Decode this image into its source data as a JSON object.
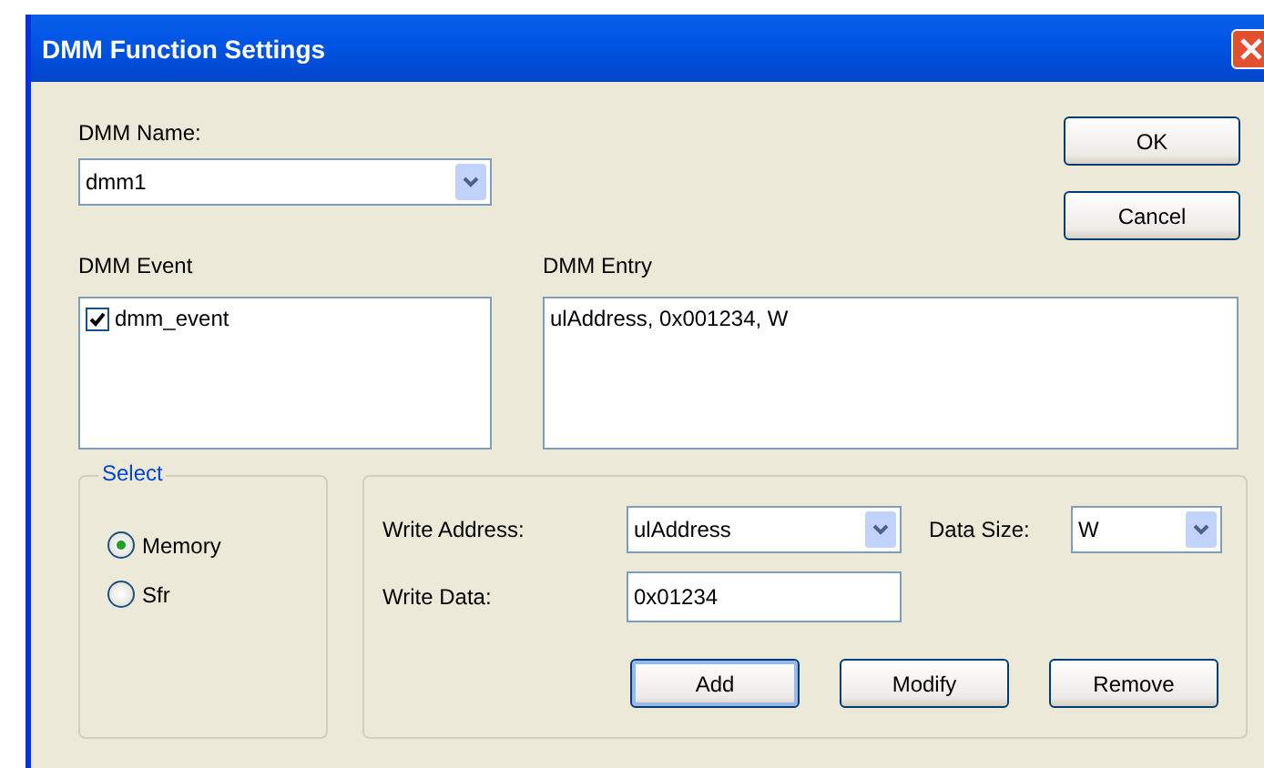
{
  "window": {
    "title": "DMM Function Settings"
  },
  "name_label": "DMM Name:",
  "name_combo": {
    "value": "dmm1"
  },
  "buttons": [
    {
      "label": "OK"
    },
    {
      "label": "Cancel"
    }
  ],
  "event_label": "DMM Event",
  "events": [
    {
      "label": "dmm_event",
      "checked": true
    }
  ],
  "entry_label": "DMM Entry",
  "entries": [
    "ulAddress, 0x001234, W"
  ],
  "select_group": {
    "legend": "Select",
    "options": [
      {
        "label": "Memory",
        "selected": true
      },
      {
        "label": "Sfr",
        "selected": false
      }
    ]
  },
  "write_address": {
    "label": "Write Address:",
    "value": "ulAddress"
  },
  "data_size": {
    "label": "Data Size:",
    "value": "W"
  },
  "write_data": {
    "label": "Write Data:",
    "value": "0x01234"
  },
  "actions": [
    {
      "label": "Add",
      "focused": true
    },
    {
      "label": "Modify",
      "focused": false
    },
    {
      "label": "Remove",
      "focused": false
    }
  ]
}
